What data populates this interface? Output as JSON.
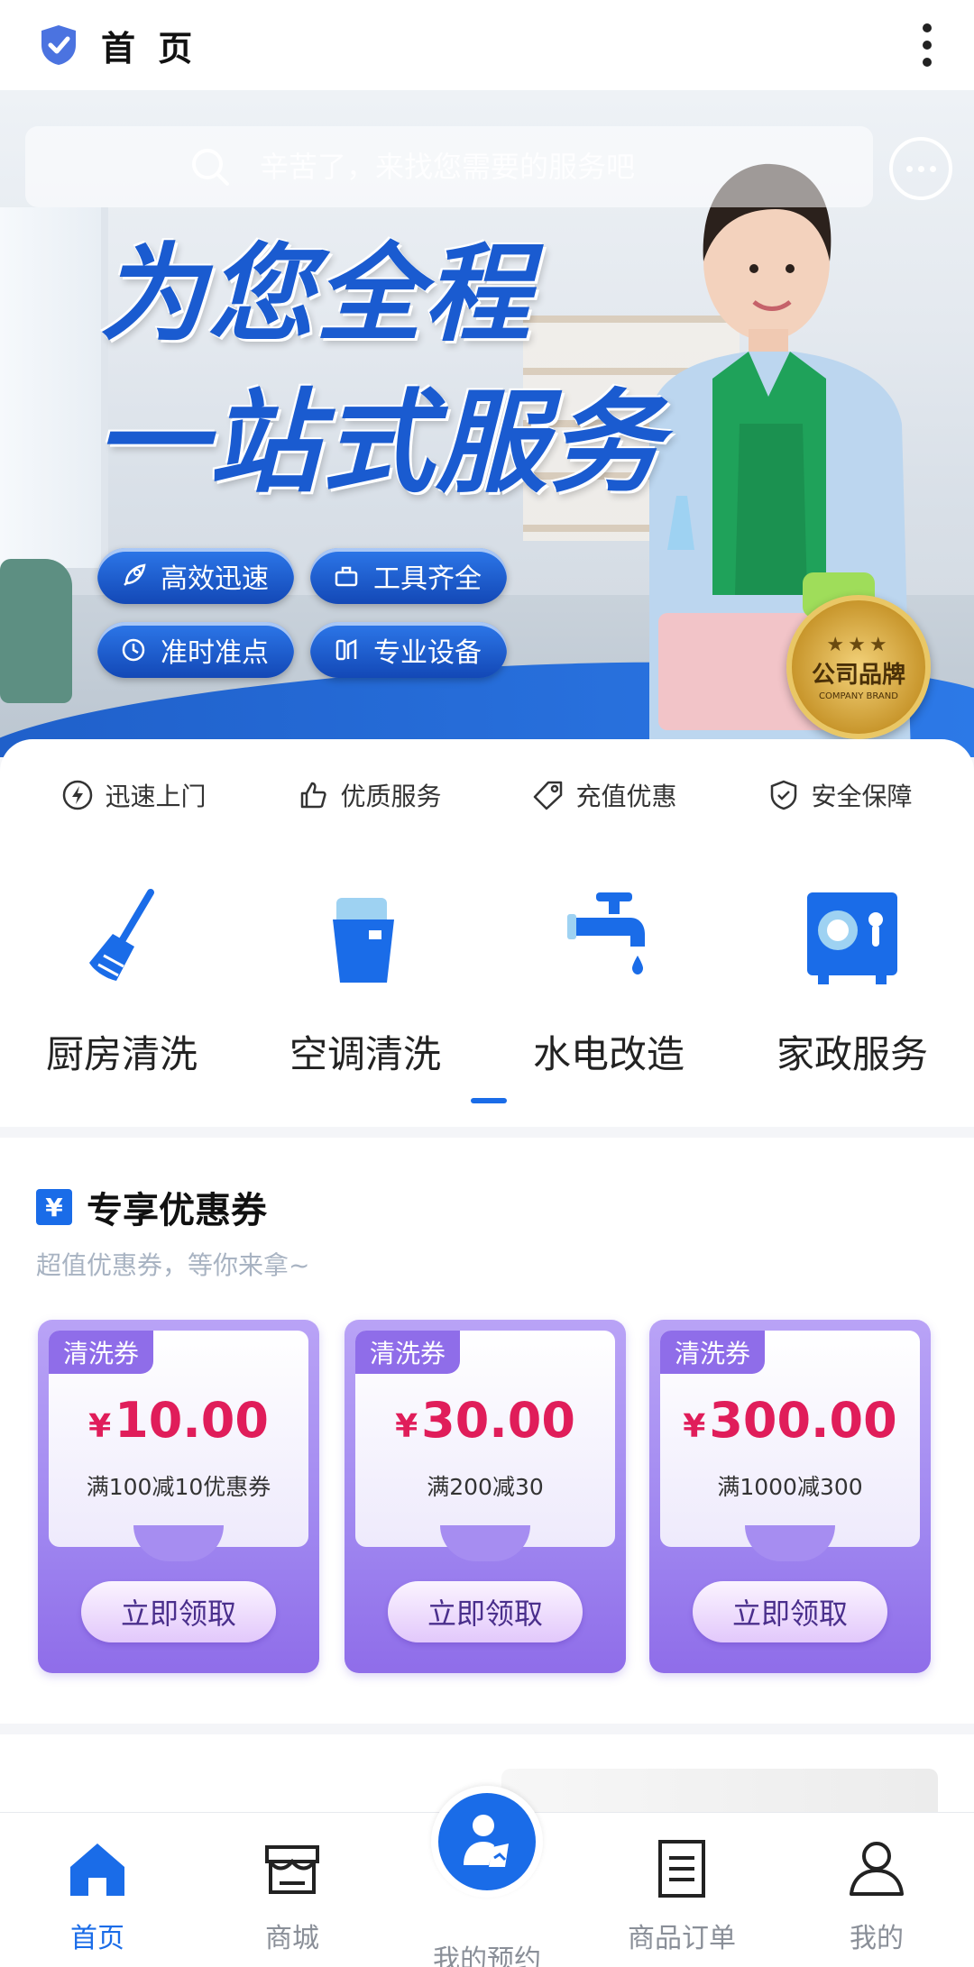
{
  "topbar": {
    "title": "首 页"
  },
  "search": {
    "placeholder": "辛苦了，来找您需要的服务吧"
  },
  "banner": {
    "headline_line1": "为您全程",
    "headline_line2": "一站式服务",
    "pills": [
      "高效迅速",
      "工具齐全",
      "准时准点",
      "专业设备"
    ],
    "medal": {
      "stars": "★★★",
      "name": "公司品牌",
      "en": "COMPANY BRAND"
    }
  },
  "features": [
    "迅速上门",
    "优质服务",
    "充值优惠",
    "安全保障"
  ],
  "services": [
    "厨房清洗",
    "空调清洗",
    "水电改造",
    "家政服务"
  ],
  "coupons": {
    "title": "专享优惠券",
    "yen_icon": "¥",
    "subtitle": "超值优惠券，等你来拿~",
    "items": [
      {
        "tag": "清洗券",
        "symbol": "¥",
        "amount": "10.00",
        "desc": "满100减10优惠券",
        "button": "立即领取"
      },
      {
        "tag": "清洗券",
        "symbol": "¥",
        "amount": "30.00",
        "desc": "满200减30",
        "button": "立即领取"
      },
      {
        "tag": "清洗券",
        "symbol": "¥",
        "amount": "300.00",
        "desc": "满1000减300",
        "button": "立即领取"
      }
    ]
  },
  "tabbar": {
    "items": [
      {
        "label": "首页",
        "icon": "home-icon",
        "active": true
      },
      {
        "label": "商城",
        "icon": "store-icon",
        "active": false
      },
      {
        "label": "我的预约",
        "icon": "booking-icon",
        "active": false
      },
      {
        "label": "商品订单",
        "icon": "orders-icon",
        "active": false
      },
      {
        "label": "我的",
        "icon": "user-icon",
        "active": false
      }
    ]
  },
  "colors": {
    "accent": "#1a6ce8",
    "coupon_price": "#e01d5a",
    "coupon_purple": "#8f6de9"
  }
}
